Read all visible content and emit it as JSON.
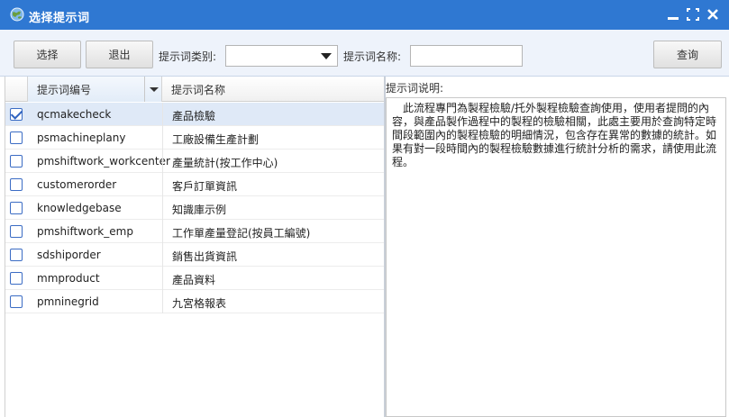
{
  "window": {
    "title": "选择提示词",
    "icon": "globe-icon",
    "controls": [
      "minimize-icon",
      "maximize-icon",
      "close-icon"
    ]
  },
  "toolbar": {
    "select_label": "选择",
    "exit_label": "退出",
    "category_label": "提示词类别:",
    "category_value": "",
    "name_label": "提示词名称:",
    "name_value": "",
    "query_label": "查询"
  },
  "grid": {
    "columns": [
      "提示词编号",
      "提示词名称"
    ],
    "rows": [
      {
        "code": "qcmakecheck",
        "name": "產品檢驗",
        "checked": true
      },
      {
        "code": "psmachineplany",
        "name": "工廠設備生產計劃",
        "checked": false
      },
      {
        "code": "pmshiftwork_workcenter",
        "name": "產量統計(按工作中心)",
        "checked": false
      },
      {
        "code": "customerorder",
        "name": "客戶訂單資訊",
        "checked": false
      },
      {
        "code": "knowledgebase",
        "name": "知識庫示例",
        "checked": false
      },
      {
        "code": "pmshiftwork_emp",
        "name": "工作單產量登記(按員工編號)",
        "checked": false
      },
      {
        "code": "sdshiporder",
        "name": "銷售出貨資訊",
        "checked": false
      },
      {
        "code": "mmproduct",
        "name": "產品資料",
        "checked": false
      },
      {
        "code": "pmninegrid",
        "name": "九宮格報表",
        "checked": false
      }
    ]
  },
  "description": {
    "label": "提示词说明:",
    "text": "此流程專門為製程檢驗/托外製程檢驗查詢使用，使用者提問的內容，與產品製作過程中的製程的檢驗相關，此處主要用於查詢特定時間段範圍內的製程檢驗的明細情況，包含存在異常的數據的統計。如果有對一段時間內的製程檢驗數據進行統計分析的需求，請使用此流程。"
  },
  "colors": {
    "titlebar": "#2f78d2",
    "toolbar_bg": "#eef3fb",
    "selected_row": "#dfe9f7",
    "checkbox": "#3b6cc4"
  }
}
